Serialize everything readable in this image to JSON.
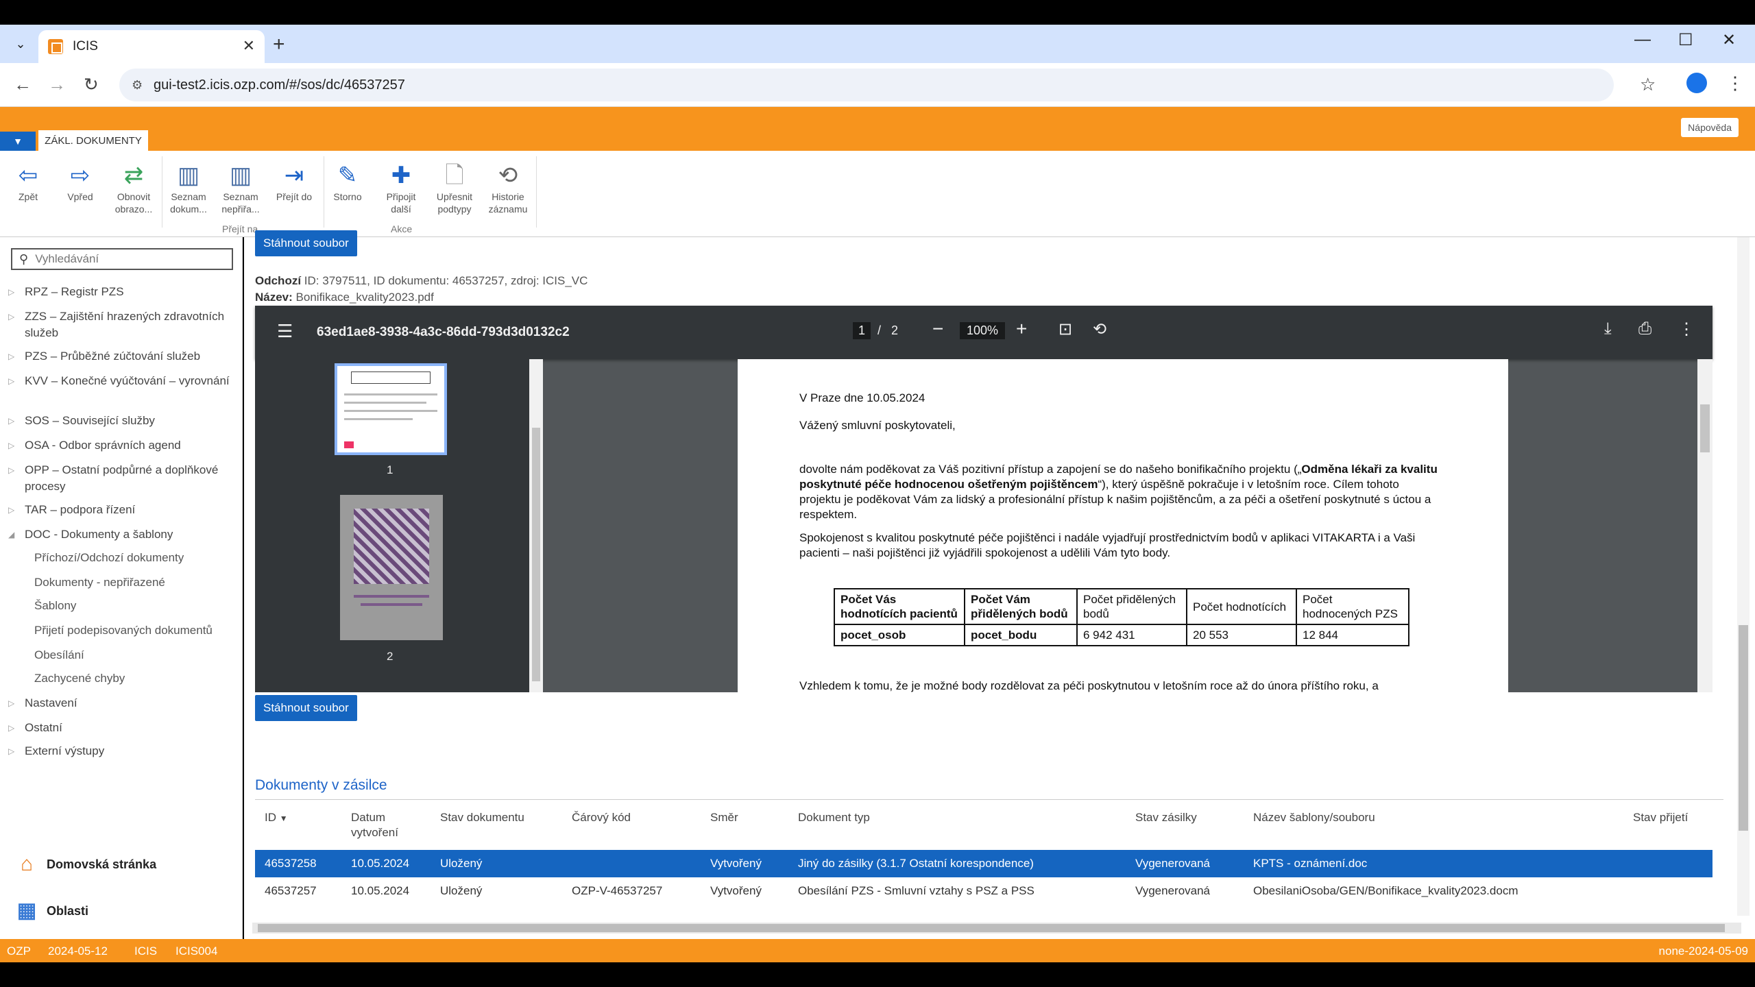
{
  "browser": {
    "tab_title": "ICIS",
    "url": "gui-test2.icis.ozp.com/#/sos/dc/46537257"
  },
  "app": {
    "help_label": "Nápověda",
    "ribbon_tab": "ZÁKL. DOKUMENTY"
  },
  "ribbon": {
    "buttons": [
      {
        "label": "Zpět",
        "icon": "arrow-left-icon"
      },
      {
        "label": "Vpřed",
        "icon": "arrow-right-icon"
      },
      {
        "label": "Obnovit obrazo...",
        "icon": "refresh-icon"
      },
      {
        "label": "Seznam dokum...",
        "icon": "list-icon"
      },
      {
        "label": "Seznam nepřiřa...",
        "icon": "list-icon"
      },
      {
        "label": "Přejít do",
        "icon": "goto-icon"
      },
      {
        "label": "Storno",
        "icon": "pencil-icon"
      },
      {
        "label": "Připojit další",
        "icon": "plus-icon"
      },
      {
        "label": "Upřesnit podtypy",
        "icon": "document-icon"
      },
      {
        "label": "Historie záznamu",
        "icon": "history-icon"
      }
    ],
    "groups": {
      "goto": "Přejít na",
      "actions": "Akce"
    }
  },
  "sidebar": {
    "search_placeholder": "Vyhledávání",
    "items": [
      "RPZ – Registr PZS",
      "ZZS – Zajištění hrazených zdravotních služeb",
      "PZS – Průběžné zúčtování služeb",
      "KVV – Konečné vyúčtování – vyrovnání",
      "SOS – Související služby",
      "OSA - Odbor správních agend",
      "OPP – Ostatní podpůrné a doplňkové procesy",
      "TAR – podpora řízení",
      "DOC - Dokumenty a šablony"
    ],
    "sub_items": [
      "Příchozí/Odchozí dokumenty",
      "Dokumenty - nepřiřazené",
      "Šablony",
      "Přijetí podepisovaných dokumentů",
      "Obesílání",
      "Zachycené chyby"
    ],
    "items2": [
      "Nastavení",
      "Ostatní",
      "Externí výstupy"
    ],
    "home": "Domovská stránka",
    "areas": "Oblasti"
  },
  "main": {
    "download_label": "Stáhnout soubor",
    "meta_line1_label": "Odchozí",
    "meta_line1_value": "ID: 3797511, ID dokumentu: 46537257, zdroj: ICIS_VC",
    "meta_line2_label": "Název:",
    "meta_line2_value": "Bonifikace_kvality2023.pdf"
  },
  "pdf": {
    "file_id": "63ed1ae8-3938-4a3c-86dd-793d3d0132c2",
    "page_current": "1",
    "page_sep": "/",
    "page_total": "2",
    "zoom": "100%",
    "thumb_labels": [
      "1",
      "2"
    ],
    "text": {
      "date_line": "V Praze dne  10.05.2024",
      "salutation": "Vážený smluvní poskytovateli,",
      "p1_a": "dovolte nám poděkovat za Váš pozitivní přístup a zapojení se do našeho bonifikačního projektu („",
      "p1_bold": "Odměna lékaři za kvalitu poskytnuté péče hodnocenou ošetřeným pojištěncem",
      "p1_b": "“), který úspěšně pokračuje i v letošním roce. Cílem tohoto projektu je poděkovat Vám za lidský a profesionální přístup k našim pojištěncům, a za péči a ošetření poskytnuté s úctou a respektem.",
      "p2": "Spokojenost s kvalitou poskytnuté péče pojištěnci i nadále vyjadřují prostřednictvím bodů v aplikaci VITAKARTA i a Vaši pacienti – naši pojištěnci již vyjádřili spokojenost a udělili Vám tyto body.",
      "p3": "Vzhledem k tomu, že je možné body rozdělovat za péči poskytnutou v letošním roce až do února příštího roku, a"
    },
    "table": {
      "headers": [
        "Počet Vás hodnotících pacientů",
        "Počet Vám přidělených bodů",
        "Počet přidělených bodů",
        "Počet hodnotících",
        "Počet hodnocených PZS"
      ],
      "row": [
        "pocet_osob",
        "pocet_bodu",
        "6 942 431",
        "20 553",
        "12 844"
      ]
    }
  },
  "docs": {
    "title": "Dokumenty v zásilce",
    "columns": [
      "ID",
      "Datum vytvoření",
      "Stav dokumentu",
      "Čárový kód",
      "Směr",
      "Dokument typ",
      "Stav zásilky",
      "Název šablony/souboru",
      "Stav přijetí"
    ],
    "rows": [
      [
        "46537258",
        "10.05.2024",
        "Uložený",
        "",
        "Vytvořený",
        "Jiný do zásilky (3.1.7 Ostatní korespondence)",
        "Vygenerovaná",
        "KPTS - oznámení.doc",
        ""
      ],
      [
        "46537257",
        "10.05.2024",
        "Uložený",
        "OZP-V-46537257",
        "Vytvořený",
        "Obesílání PZS - Smluvní vztahy s PSZ a PSS",
        "Vygenerovaná",
        "ObesilaniOsoba/GEN/Bonifikace_kvality2023.docm",
        ""
      ]
    ]
  },
  "status": {
    "org": "OZP",
    "date": "2024-05-12",
    "app": "ICIS",
    "server": "ICIS004",
    "right": "none-2024-05-09"
  },
  "colors": {
    "accent": "#f7941d",
    "primary": "#1565c0"
  }
}
